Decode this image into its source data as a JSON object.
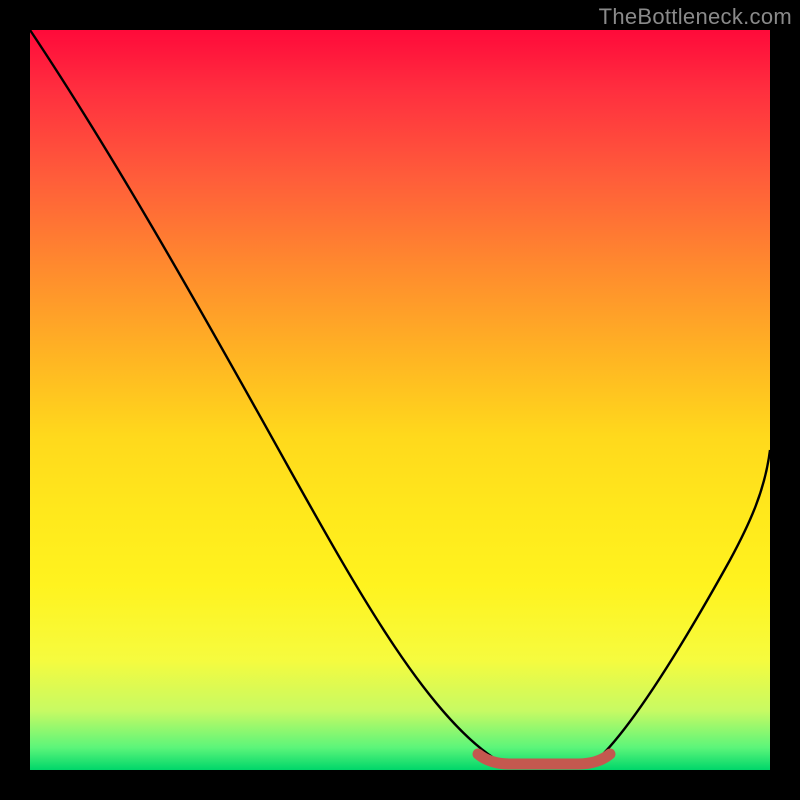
{
  "watermark": "TheBottleneck.com",
  "colors": {
    "frame": "#000000",
    "gradient_top": "#ff0a3a",
    "gradient_mid": "#ffe81c",
    "gradient_bottom": "#00d66a",
    "curve": "#000000",
    "marker": "#c4584f"
  },
  "chart_data": {
    "type": "line",
    "title": "",
    "xlabel": "",
    "ylabel": "",
    "xlim": [
      0,
      100
    ],
    "ylim": [
      0,
      100
    ],
    "grid": false,
    "series": [
      {
        "name": "bottleneck-curve",
        "x": [
          0,
          10,
          20,
          30,
          40,
          50,
          55,
          60,
          65,
          70,
          75,
          80,
          85,
          90,
          95,
          100
        ],
        "values": [
          100,
          85,
          70,
          55,
          40,
          25,
          15,
          5,
          0,
          0,
          0,
          5,
          13,
          22,
          32,
          43
        ]
      }
    ],
    "annotations": [
      {
        "name": "bottom-marker",
        "shape": "rounded-segment",
        "x_range": [
          60,
          76
        ],
        "y": 0
      }
    ]
  }
}
